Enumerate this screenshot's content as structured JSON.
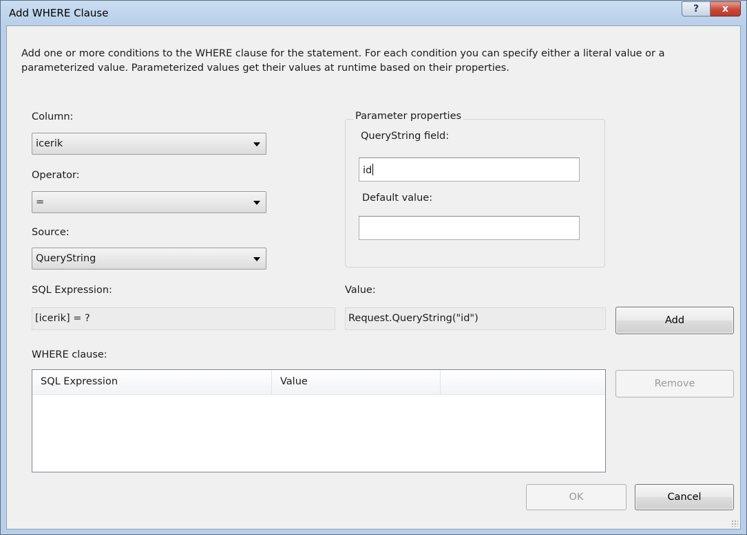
{
  "window": {
    "title": "Add WHERE Clause",
    "help_glyph": "?",
    "close_glyph": "x"
  },
  "intro": "Add one or more conditions to the WHERE clause for the statement. For each condition you can specify either a literal value or a parameterized value. Parameterized values get their values at runtime based on their properties.",
  "column": {
    "label": "Column:",
    "value": "icerik"
  },
  "operator": {
    "label": "Operator:",
    "value": "="
  },
  "source": {
    "label": "Source:",
    "value": "QueryString"
  },
  "parameter_properties": {
    "legend": "Parameter properties",
    "querystring_field_label": "QueryString field:",
    "querystring_field_value": "id",
    "default_value_label": "Default value:",
    "default_value": ""
  },
  "sql_expression": {
    "label": "SQL Expression:",
    "value": "[icerik] = ?"
  },
  "value": {
    "label": "Value:",
    "value": "Request.QueryString(\"id\")"
  },
  "buttons": {
    "add": "Add",
    "remove": "Remove",
    "ok": "OK",
    "cancel": "Cancel"
  },
  "where_clause": {
    "label": "WHERE clause:",
    "columns": [
      "SQL Expression",
      "Value",
      ""
    ],
    "rows": []
  }
}
